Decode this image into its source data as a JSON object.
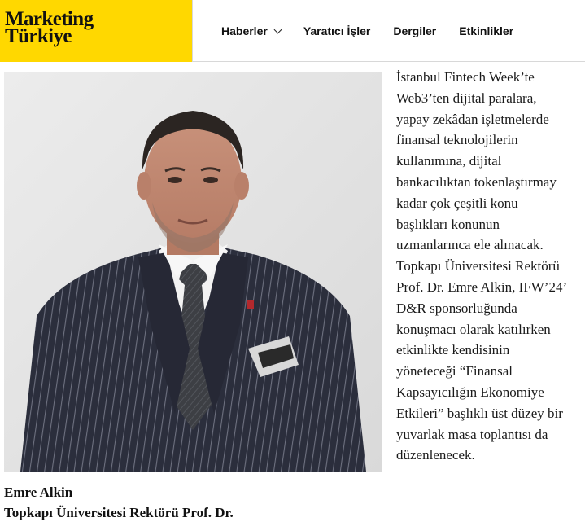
{
  "header": {
    "logo_line1": "Marketing",
    "logo_line2": "Türkiye",
    "logo_bg": "#ffd800",
    "nav": [
      {
        "label": "Haberler",
        "has_dropdown": true
      },
      {
        "label": "Yaratıcı İşler",
        "has_dropdown": false
      },
      {
        "label": "Dergiler",
        "has_dropdown": false
      },
      {
        "label": "Etkinlikler",
        "has_dropdown": false
      }
    ]
  },
  "photo": {
    "alt": "Emre Alkin"
  },
  "caption": {
    "name": "Emre Alkin",
    "role": "Topkapı Üniversitesi Rektörü Prof. Dr."
  },
  "article": {
    "lines": [
      "İstanbul Fintech Week’te",
      "Web3’ten dijital paralara,",
      "yapay zekâdan işletmelerde",
      "finansal teknolojilerin",
      "kullanımına, dijital",
      "bankacılıktan tokenlaştırmay",
      "kadar çok çeşitli konu",
      "başlıkları konunun",
      "uzmanlarınca ele alınacak.",
      "Topkapı Üniversitesi Rektörü",
      "Prof. Dr. Emre Alkin, IFW’24’",
      "D&R sponsorluğunda",
      "konuşmacı olarak katılırken",
      "etkinlikte kendisinin",
      "yöneteceği “Finansal",
      "Kapsayıcılığın Ekonomiye",
      "Etkileri” başlıklı üst düzey bir",
      "yuvarlak masa toplantısı da",
      "düzenlenecek."
    ]
  }
}
